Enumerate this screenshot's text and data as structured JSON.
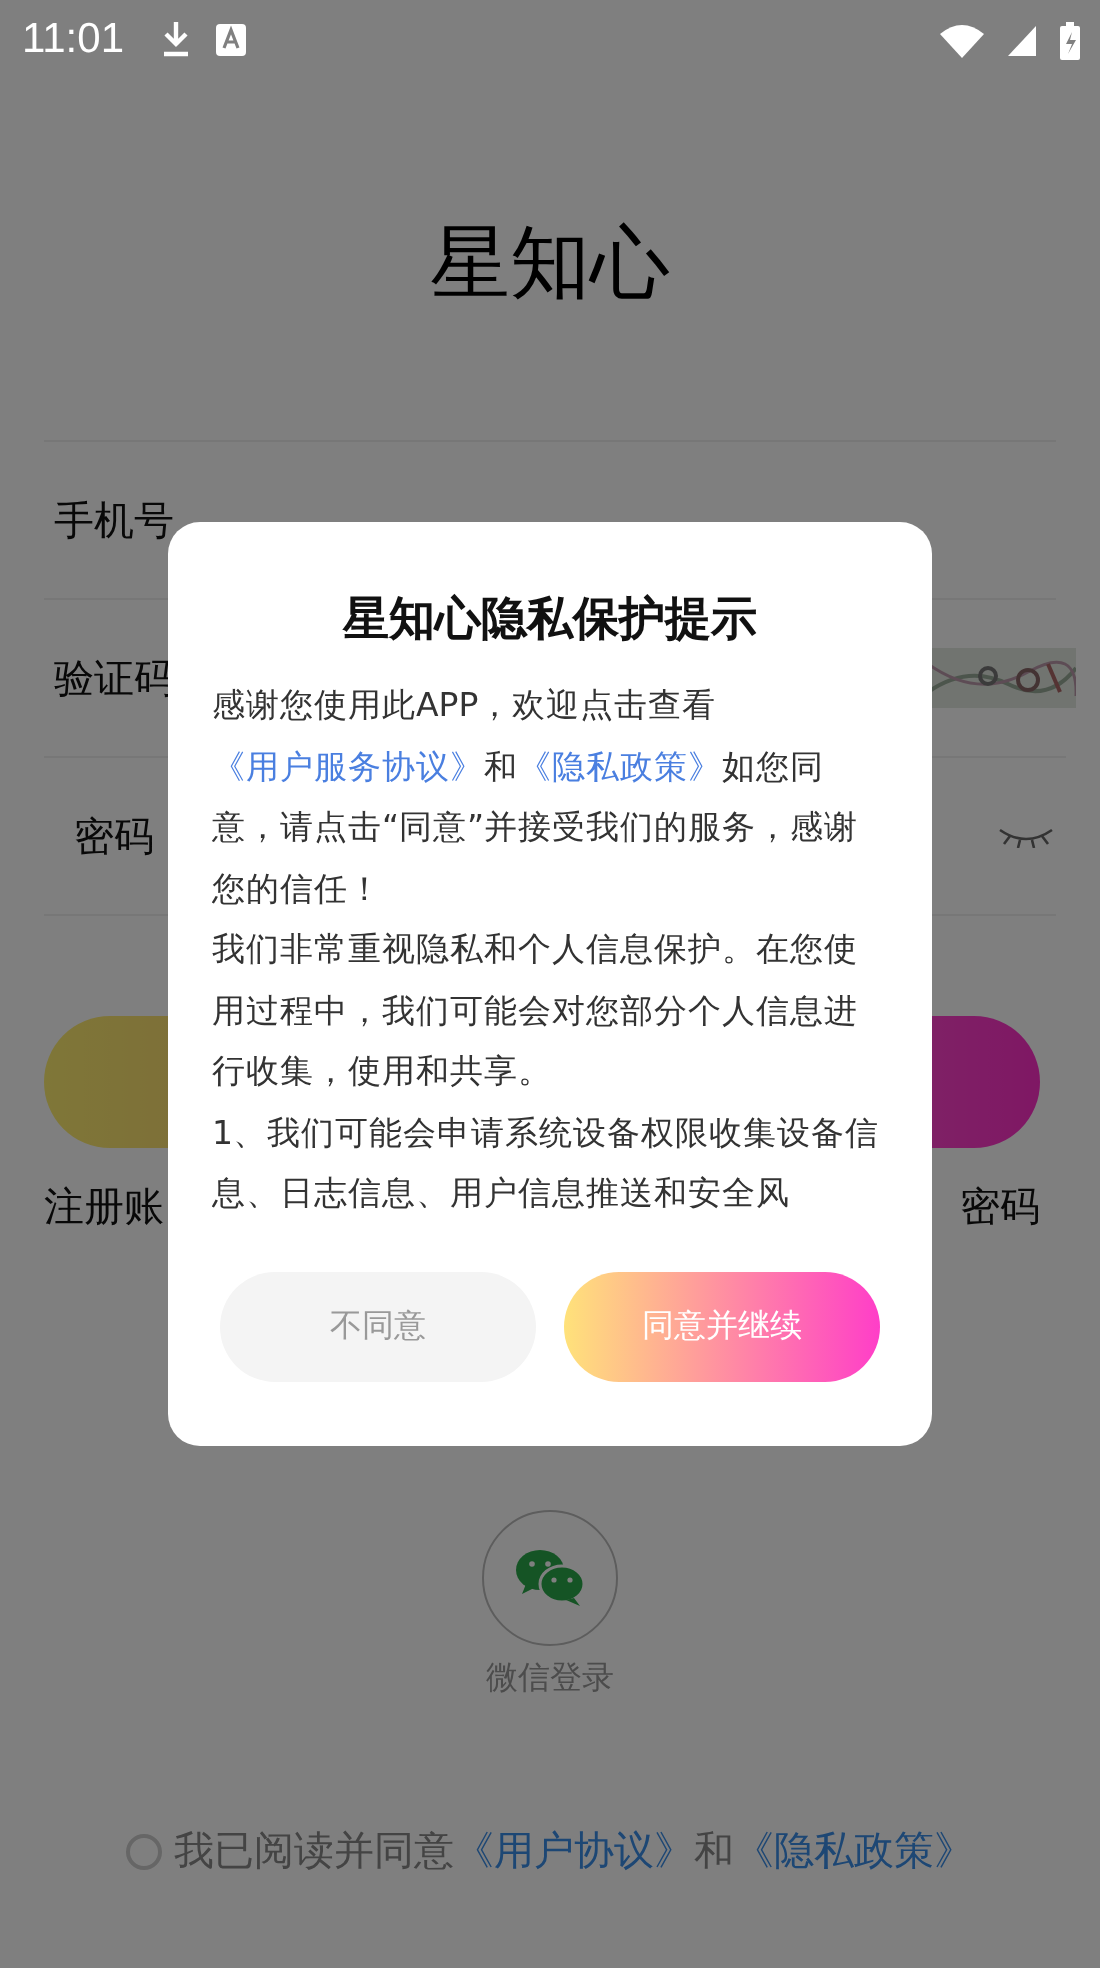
{
  "status_bar": {
    "time": "11:01"
  },
  "app": {
    "title": "星知心",
    "fields": [
      {
        "kind": "phone",
        "label": "手机号"
      },
      {
        "kind": "captcha",
        "label": "验证码"
      },
      {
        "kind": "password",
        "label": "密码"
      }
    ],
    "register_link": "注册账",
    "forgot_link": "密码",
    "wechat_login": "微信登录",
    "agreement": {
      "checked": false,
      "segments": [
        {
          "kind": "text",
          "text": "我已阅读并同意"
        },
        {
          "kind": "link",
          "text": "《用户协议》"
        },
        {
          "kind": "text",
          "text": "和"
        },
        {
          "kind": "link",
          "text": "《隐私政策》"
        }
      ]
    }
  },
  "dialog": {
    "title": "星知心隐私保护提示",
    "paragraphs": [
      [
        {
          "kind": "text",
          "text": "感谢您使用此APP，欢迎点击查看"
        },
        {
          "kind": "link",
          "text": "《用户服务协议》"
        },
        {
          "kind": "text",
          "text": "和"
        },
        {
          "kind": "link",
          "text": "《隐私政策》"
        },
        {
          "kind": "text",
          "text": "如您同意，请点击“同意”并接受我们的服务，感谢您的信任！"
        }
      ],
      [
        {
          "kind": "text",
          "text": "我们非常重视隐私和个人信息保护。在您使用过程中，我们可能会对您部分个人信息进行收集，使用和共享。"
        }
      ],
      [
        {
          "kind": "text",
          "text": "1、我们可能会申请系统设备权限收集设备信息、日志信息、用户信息推送和安全风"
        }
      ]
    ],
    "buttons": [
      {
        "kind": "secondary",
        "label": "不同意"
      },
      {
        "kind": "primary",
        "label": "同意并继续"
      }
    ]
  }
}
